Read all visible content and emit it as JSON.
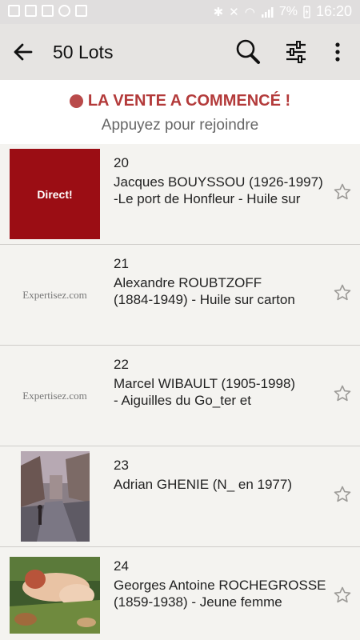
{
  "status_bar": {
    "battery": "7%",
    "time": "16:20"
  },
  "app_bar": {
    "title": "50 Lots"
  },
  "banner": {
    "title": "LA VENTE A COMMENCÉ !",
    "subtitle": "Appuyez pour rejoindre",
    "dot_color": "#b94a4a"
  },
  "lots": [
    {
      "number": "20",
      "line1": "Jacques BOUYSSOU (1926-1997)",
      "line2": "-Le port de Honfleur - Huile sur",
      "thumb_type": "direct",
      "thumb_text": "Direct!"
    },
    {
      "number": "21",
      "line1": "Alexandre ROUBTZOFF",
      "line2": "(1884-1949) - Huile sur carton",
      "thumb_type": "logo",
      "thumb_text": "Expertisez.com"
    },
    {
      "number": "22",
      "line1": "Marcel WIBAULT (1905-1998)",
      "line2": "- Aiguilles du Go_ter et",
      "thumb_type": "logo",
      "thumb_text": "Expertisez.com"
    },
    {
      "number": "23",
      "line1": "Adrian GHENIE (N_ en 1977)",
      "line2": "",
      "thumb_type": "painting-street"
    },
    {
      "number": "24",
      "line1": "Georges Antoine ROCHEGROSSE",
      "line2": "(1859-1938) - Jeune femme",
      "thumb_type": "painting-figure"
    }
  ],
  "colors": {
    "accent": "#b33a3a",
    "direct_bg": "#9b0d14",
    "app_bar": "#e6e4e2",
    "list_bg": "#f4f3f0"
  }
}
